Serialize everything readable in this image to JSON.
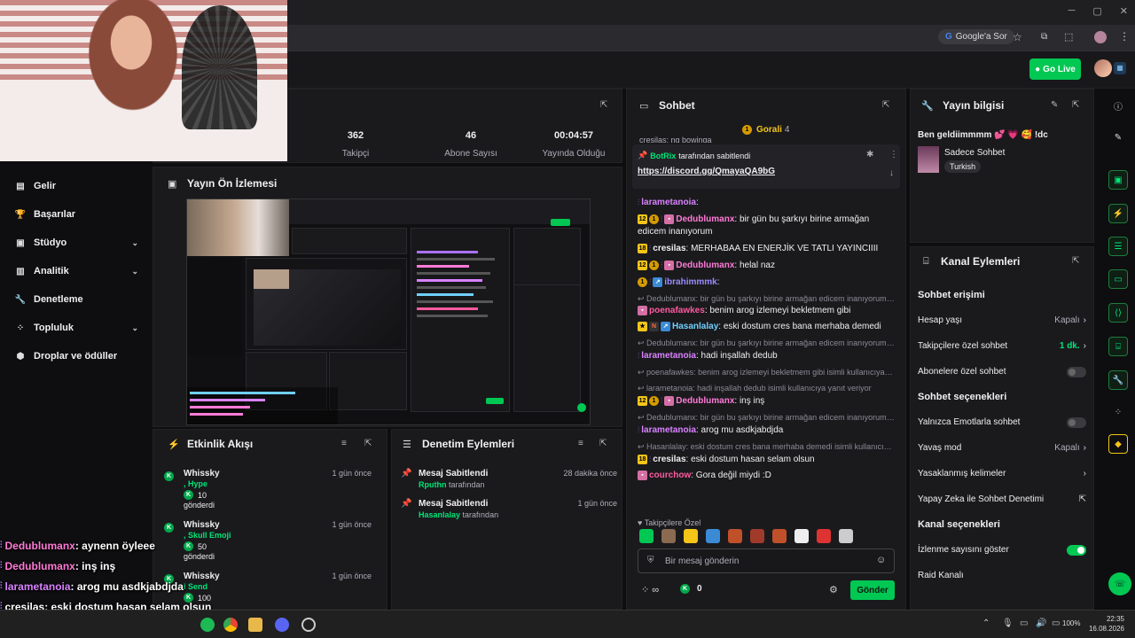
{
  "browser": {
    "google_label": "Google'a Sor"
  },
  "header": {
    "go_live_label": "Go Live"
  },
  "sidebar": {
    "items": [
      {
        "label": "Gelir",
        "icon": "wallet-icon",
        "expand": false
      },
      {
        "label": "Başarılar",
        "icon": "trophy-icon",
        "expand": false
      },
      {
        "label": "Stüdyo",
        "icon": "studio-icon",
        "expand": true
      },
      {
        "label": "Analitik",
        "icon": "analytics-icon",
        "expand": true
      },
      {
        "label": "Denetleme",
        "icon": "wrench-icon",
        "expand": false
      },
      {
        "label": "Topluluk",
        "icon": "community-icon",
        "expand": true
      },
      {
        "label": "Droplar ve ödüller",
        "icon": "drops-icon",
        "expand": false
      }
    ]
  },
  "stats": {
    "followers_value": "362",
    "followers_label": "Takipçi",
    "subs_value": "46",
    "subs_label": "Abone Sayısı",
    "uptime_value": "00:04:57",
    "uptime_label": "Yayında Olduğu Süre"
  },
  "preview": {
    "title": "Yayın Ön İzlemesi"
  },
  "event_feed": {
    "title": "Etkinlik Akışı",
    "items": [
      {
        "name": "Whissky",
        "detail": ", Hype",
        "count": "10",
        "action": "gönderdi",
        "time": "1 gün önce"
      },
      {
        "name": "Whissky",
        "detail": ", Skull Emoji",
        "count": "50",
        "action": "gönderdi",
        "time": "1 gün önce"
      },
      {
        "name": "Whissky",
        "detail": "i Send",
        "count": "100",
        "action": "",
        "time": "1 gün önce"
      }
    ]
  },
  "mod_actions": {
    "title": "Denetim Eylemleri",
    "items": [
      {
        "action": "Mesaj Sabitlendi",
        "user": "Rputhn",
        "suffix": "tarafından",
        "time": "28 dakika önce"
      },
      {
        "action": "Mesaj Sabitlendi",
        "user": "Hasanlalay",
        "suffix": "tarafından",
        "time": "1 gün önce"
      }
    ]
  },
  "chat": {
    "title": "Sohbet",
    "top_user": "Gorali",
    "top_count": "4",
    "pinned_by": "BotRix",
    "pinned_suffix": "tarafından sabitlendi",
    "pinned_link": "https://discord.gg/QmayaQA9bG",
    "partial_top": "cresilas: ng bowinga",
    "messages": [
      {
        "reply": "",
        "badges": [
          "sub"
        ],
        "user": "larametanoia",
        "color": "#d982ff",
        "text": ":"
      },
      {
        "reply": "",
        "badges": [
          "12",
          "coin",
          "sub",
          "gift"
        ],
        "user": "Dedublumanx",
        "color": "#ff7bd6",
        "text": ": bir gün bu şarkıyı birine armağan edicem inanıyorum"
      },
      {
        "reply": "",
        "badges": [
          "18",
          "sub"
        ],
        "user": "cresilas",
        "color": "#efeff1",
        "text": ": MERHABAA EN ENERJİK VE TATLI YAYINCIIII"
      },
      {
        "reply": "",
        "badges": [
          "12",
          "coin",
          "sub",
          "gift"
        ],
        "user": "Dedublumanx",
        "color": "#ff7bd6",
        "text": ": helal naz"
      },
      {
        "reply": "",
        "badges": [
          "coin",
          "sub",
          "arrow"
        ],
        "user": "ibrahimmmk",
        "color": "#9b8cff",
        "text": ":"
      },
      {
        "reply": "Dedublumanx: bir gün bu şarkıyı birine armağan edicem inanıyorum isi...",
        "badges": [
          "gift"
        ],
        "user": "poenafawkes",
        "color": "#ff5aa0",
        "text": ": benim arog izlemeyi bekletmem gibi"
      },
      {
        "reply": "",
        "badges": [
          "star",
          "N",
          "arrow"
        ],
        "user": "Hasanlalay",
        "color": "#6fd0ff",
        "text": ": eski dostum cres bana merhaba demedi"
      },
      {
        "reply": "Dedublumanx: bir gün bu şarkıyı birine armağan edicem inanıyorum isi...",
        "badges": [
          "sub"
        ],
        "user": "larametanoia",
        "color": "#d982ff",
        "text": ": hadi inşallah dedub"
      },
      {
        "reply": "poenafawkes: benim arog izlemeyi bekletmem gibi isimli kullanıcıya ya...",
        "badges": [],
        "user": "",
        "color": "",
        "text": ""
      },
      {
        "reply": "larametanoia: hadi inşallah dedub isimli kullanıcıya yanıt veriyor",
        "badges": [
          "12",
          "coin",
          "sub",
          "gift"
        ],
        "user": "Dedublumanx",
        "color": "#ff7bd6",
        "text": ": inş inş"
      },
      {
        "reply": "Dedublumanx: bir gün bu şarkıyı birine armağan edicem inanıyorum isi...",
        "badges": [
          "sub"
        ],
        "user": "larametanoia",
        "color": "#d982ff",
        "text": ": arog mu asdkjabdjda"
      },
      {
        "reply": "Hasanlalay: eski dostum cres bana merhaba demedi isimli kullanıcıya ...",
        "badges": [
          "18",
          "sub"
        ],
        "user": "cresilas",
        "color": "#efeff1",
        "text": ": eski dostum hasan selam olsun"
      },
      {
        "reply": "",
        "badges": [
          "gift"
        ],
        "user": "courchow",
        "color": "#ff5aa0",
        "text": ": Gora değil miydi :D"
      }
    ],
    "followers_only": "Takipçilere Özel",
    "input_placeholder": "Bir mesaj gönderin",
    "points": "0",
    "send_label": "Gönder"
  },
  "stream_info": {
    "title": "Yayın bilgisi",
    "stream_title": "Ben geldiimmmm 💕 💗 🥰 !dc",
    "category": "Sadece Sohbet",
    "tag": "Turkish"
  },
  "channel_actions": {
    "title": "Kanal Eylemleri",
    "chat_access_title": "Sohbet erişimi",
    "access_rows": [
      {
        "label": "Hesap yaşı",
        "value": "Kapalı",
        "type": "chev"
      },
      {
        "label": "Takipçilere özel sohbet",
        "value": "1 dk.",
        "type": "chev-green"
      },
      {
        "label": "Abonelere özel sohbet",
        "value": "",
        "type": "toggle-off"
      }
    ],
    "chat_options_title": "Sohbet seçenekleri",
    "option_rows": [
      {
        "label": "Yalnızca Emotlarla sohbet",
        "value": "",
        "type": "toggle-off"
      },
      {
        "label": "Yavaş mod",
        "value": "Kapalı",
        "type": "chev"
      },
      {
        "label": "Yasaklanmış kelimeler",
        "value": "",
        "type": "chev"
      },
      {
        "label": "Yapay Zeka ile Sohbet Denetimi",
        "value": "",
        "type": "ext"
      }
    ],
    "channel_options_title": "Kanal seçenekleri",
    "channel_rows": [
      {
        "label": "İzlenme sayısını göster",
        "value": "",
        "type": "toggle-on"
      },
      {
        "label": "Raid Kanalı",
        "value": "",
        "type": "none"
      }
    ]
  },
  "overlay": {
    "lines": [
      {
        "user": "Dedublumanx",
        "color": "#ff7bd6",
        "text": ": aynenn öyleee"
      },
      {
        "user": "Dedublumanx",
        "color": "#ff7bd6",
        "text": ": inş inş"
      },
      {
        "user": "larametanoia",
        "color": "#d982ff",
        "text": ": arog mu asdkjabdjda"
      },
      {
        "user": "cresilas",
        "color": "#ffffff",
        "text": ": eski dostum hasan selam olsun"
      },
      {
        "user": "courchow",
        "color": "#ff5aa0",
        "text": ": Gora değil miydi :D"
      }
    ]
  },
  "taskbar": {
    "time": "22:35",
    "date": "16.08.2026",
    "battery": "100%"
  },
  "colors": {
    "accent": "#00c853",
    "panel_bg": "#1a1a1d",
    "page_bg": "#0e0e10"
  }
}
